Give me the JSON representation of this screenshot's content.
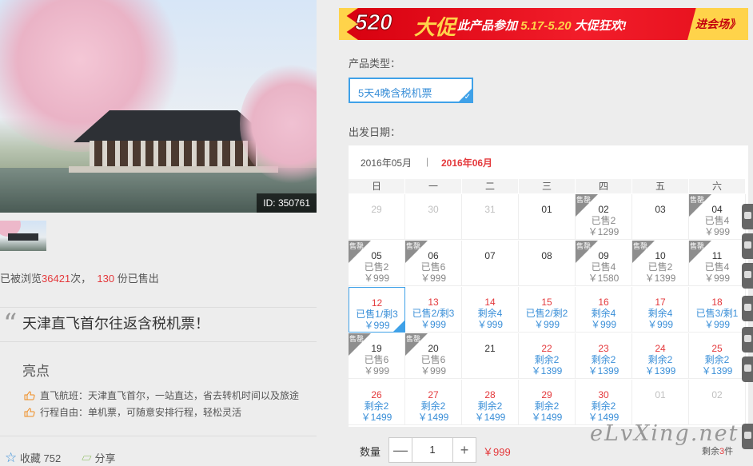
{
  "hero": {
    "id_badge": "ID: 350761"
  },
  "stats": {
    "prefix": "已被浏览",
    "views": "36421",
    "views_suffix": "次，",
    "sold": "130",
    "sold_suffix": "份已售出"
  },
  "product": {
    "title": "天津直飞首尔往返含税机票！"
  },
  "highlights": {
    "title": "亮点",
    "items": [
      "直飞航班：天津直飞首尔，一站直达，省去转机时间以及旅途",
      "行程自由：单机票，可随意安排行程，轻松灵活"
    ]
  },
  "bottom_left": {
    "collect": "收藏 752",
    "share": "分享"
  },
  "banner": {
    "big": "520",
    "big2": "大促",
    "text_pre": "此产品参加",
    "dates": "5.17-5.20",
    "text_post": "大促狂欢!",
    "enter": "进会场》"
  },
  "form": {
    "type_label": "产品类型：",
    "type_value": "5天4晚含税机票",
    "date_label": "出发日期："
  },
  "calendar": {
    "month_tabs": [
      "2016年05月",
      "2016年06月"
    ],
    "active_month": "2016年06月",
    "tab_separator": "|",
    "weekdays": [
      "日",
      "一",
      "二",
      "三",
      "四",
      "五",
      "六"
    ],
    "tag_text": "售罄",
    "rows": [
      [
        {
          "d": "29",
          "k": "g"
        },
        {
          "d": "30",
          "k": "g"
        },
        {
          "d": "31",
          "k": "g"
        },
        {
          "d": "01",
          "k": "n"
        },
        {
          "d": "02",
          "k": "n",
          "s": "已售2",
          "p": "￥1299",
          "t": 1
        },
        {
          "d": "03",
          "k": "n"
        },
        {
          "d": "04",
          "k": "n",
          "s": "已售4",
          "p": "￥999",
          "t": 1
        }
      ],
      [
        {
          "d": "05",
          "k": "n",
          "s": "已售2",
          "p": "￥999",
          "t": 1
        },
        {
          "d": "06",
          "k": "n",
          "s": "已售6",
          "p": "￥999",
          "t": 1
        },
        {
          "d": "07",
          "k": "n"
        },
        {
          "d": "08",
          "k": "n"
        },
        {
          "d": "09",
          "k": "n",
          "s": "已售4",
          "p": "￥1580",
          "t": 1
        },
        {
          "d": "10",
          "k": "n",
          "s": "已售2",
          "p": "￥1399",
          "t": 1
        },
        {
          "d": "11",
          "k": "n",
          "s": "已售4",
          "p": "￥999",
          "t": 1
        }
      ],
      [
        {
          "d": "12",
          "k": "r",
          "s": "已售1/剩3",
          "p": "￥999",
          "sel": 1
        },
        {
          "d": "13",
          "k": "r",
          "s": "已售2/剩3",
          "p": "￥999"
        },
        {
          "d": "14",
          "k": "r",
          "s": "剩余4",
          "p": "￥999"
        },
        {
          "d": "15",
          "k": "r",
          "s": "已售2/剩2",
          "p": "￥999"
        },
        {
          "d": "16",
          "k": "r",
          "s": "剩余4",
          "p": "￥999"
        },
        {
          "d": "17",
          "k": "r",
          "s": "剩余4",
          "p": "￥999"
        },
        {
          "d": "18",
          "k": "r",
          "s": "已售3/剩1",
          "p": "￥999"
        }
      ],
      [
        {
          "d": "19",
          "k": "n",
          "s": "已售6",
          "p": "￥999",
          "t": 1
        },
        {
          "d": "20",
          "k": "n",
          "s": "已售6",
          "p": "￥999",
          "t": 1
        },
        {
          "d": "21",
          "k": "n"
        },
        {
          "d": "22",
          "k": "r",
          "s": "剩余2",
          "p": "￥1399"
        },
        {
          "d": "23",
          "k": "r",
          "s": "剩余2",
          "p": "￥1399"
        },
        {
          "d": "24",
          "k": "r",
          "s": "剩余2",
          "p": "￥1399"
        },
        {
          "d": "25",
          "k": "r",
          "s": "剩余2",
          "p": "￥1399"
        }
      ],
      [
        {
          "d": "26",
          "k": "r",
          "s": "剩余2",
          "p": "￥1499"
        },
        {
          "d": "27",
          "k": "r",
          "s": "剩余2",
          "p": "￥1499"
        },
        {
          "d": "28",
          "k": "r",
          "s": "剩余2",
          "p": "￥1499"
        },
        {
          "d": "29",
          "k": "r",
          "s": "剩余2",
          "p": "￥1499"
        },
        {
          "d": "30",
          "k": "r",
          "s": "剩余2",
          "p": "￥1499"
        },
        {
          "d": "01",
          "k": "g"
        },
        {
          "d": "02",
          "k": "g"
        }
      ]
    ]
  },
  "quantity": {
    "label": "数量",
    "minus": "—",
    "value": "1",
    "plus": "+",
    "price": "￥999",
    "remain_pre": "剩余",
    "remain_num": "3",
    "remain_post": "件"
  },
  "watermark": "eLvXing.net",
  "colors": {
    "accent_red": "#e4393c",
    "accent_blue": "#3a8fd8",
    "select_border": "#3fa1e8",
    "banner_red": "#e40e1b",
    "banner_yellow": "#ffd34a"
  }
}
